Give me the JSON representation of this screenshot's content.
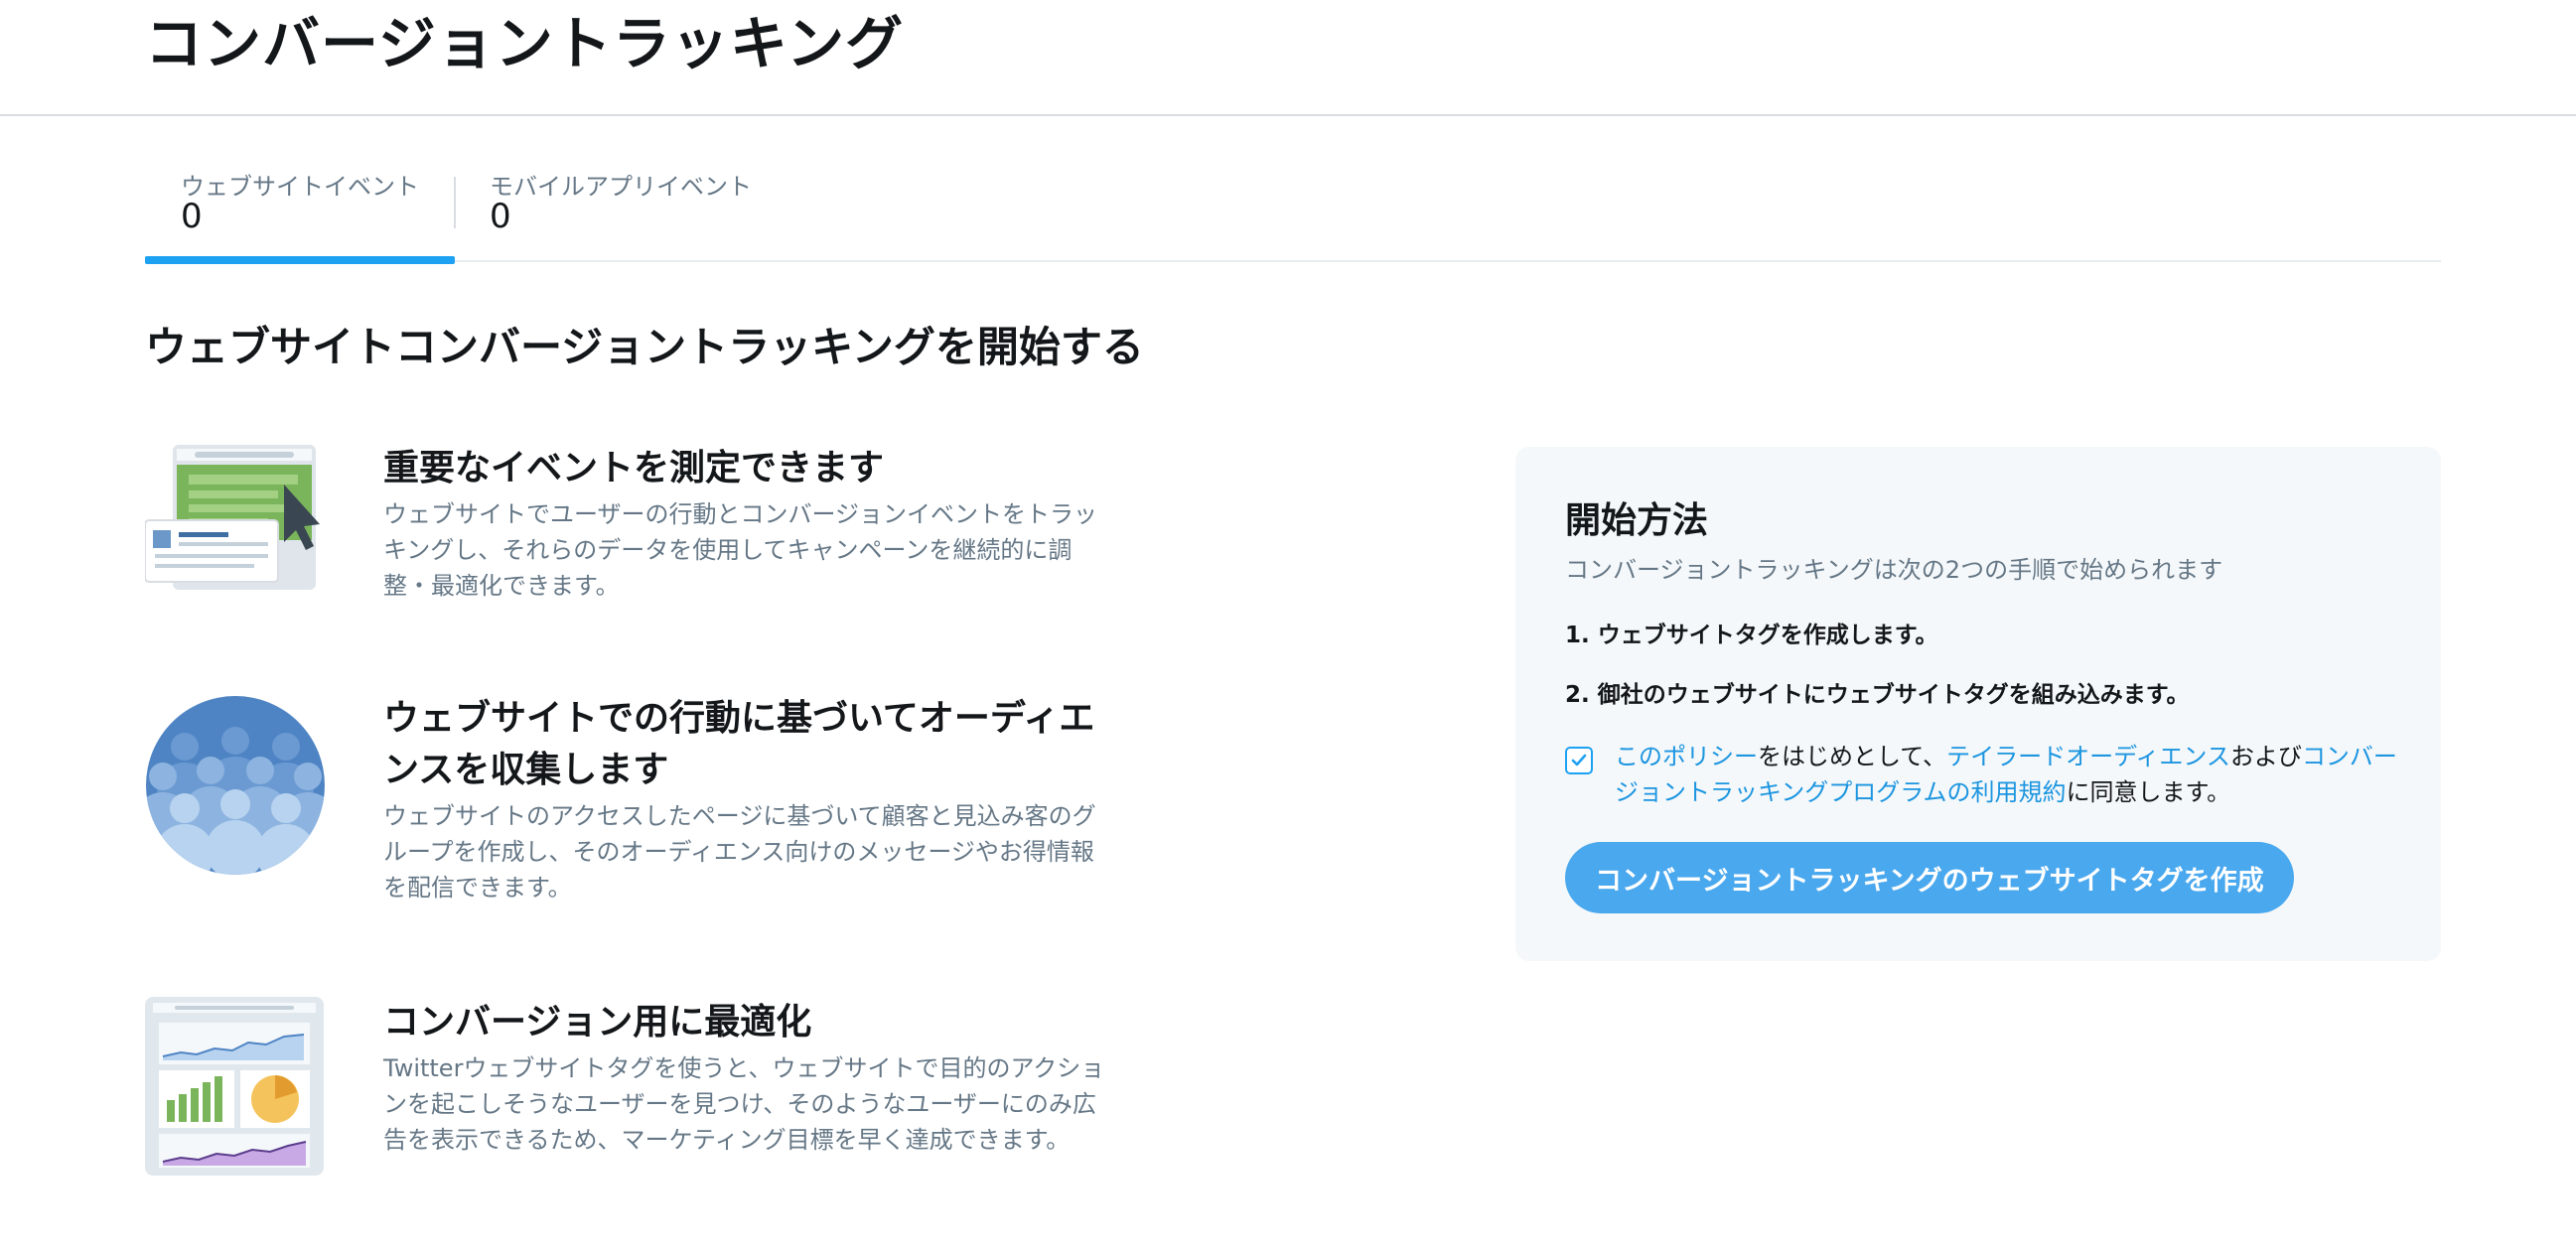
{
  "page": {
    "title": "コンバージョントラッキング"
  },
  "tabs": [
    {
      "label": "ウェブサイトイベント",
      "count": "0",
      "active": true
    },
    {
      "label": "モバイルアプリイベント",
      "count": "0",
      "active": false
    }
  ],
  "section": {
    "title": "ウェブサイトコンバージョントラッキングを開始する"
  },
  "features": [
    {
      "icon": "webpage-cursor-illustration",
      "title": "重要なイベントを測定できます",
      "desc_lines": [
        "ウェブサイトでユーザーの行動とコンバージョンイベントをトラッ",
        "キングし、それらのデータを使用してキャンペーンを継続的に調",
        "整・最適化できます。"
      ]
    },
    {
      "icon": "audience-illustration",
      "title_lines": [
        "ウェブサイトでの行動に基づいてオーディエ",
        "ンスを収集します"
      ],
      "desc_lines": [
        "ウェブサイトのアクセスしたページに基づいて顧客と見込み客のグ",
        "ループを作成し、そのオーディエンス向けのメッセージやお得情報",
        "を配信できます。"
      ]
    },
    {
      "icon": "analytics-dashboard-illustration",
      "title": "コンバージョン用に最適化",
      "desc_lines": [
        "Twitterウェブサイトタグを使うと、ウェブサイトで目的のアクショ",
        "ンを起こしそうなユーザーを見つけ、そのようなユーザーにのみ広",
        "告を表示できるため、マーケティング目標を早く達成できます。"
      ]
    }
  ],
  "card": {
    "title": "開始方法",
    "subtitle": "コンバージョントラッキングは次の2つの手順で始められます",
    "step1": "1. ウェブサイトタグを作成します。",
    "step2": "2. 御社のウェブサイトにウェブサイトタグを組み込みます。",
    "agreement": {
      "checked": true,
      "link_policy": "このポリシー",
      "text_after_policy": "をはじめとして、",
      "link_tailored": "テイラードオーディエンス",
      "text_and": "および",
      "link_terms": "コンバージョントラッキングプログラムの利用規約",
      "text_end": "に同意します。"
    },
    "button_label": "コンバージョントラッキングのウェブサイトタグを作成"
  },
  "colors": {
    "accent": "#1da1f2",
    "link": "#1b95e0",
    "button": "#4aa8ee",
    "muted": "#657786",
    "card_bg": "#f5f8fa"
  }
}
